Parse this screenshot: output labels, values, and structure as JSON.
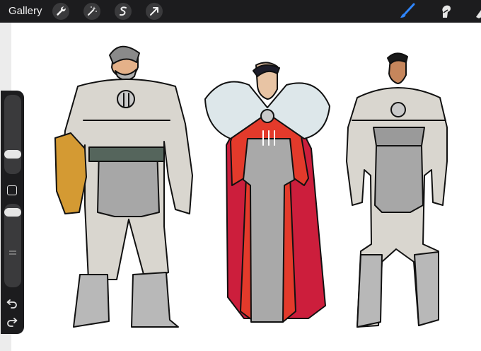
{
  "toolbar": {
    "gallery_label": "Gallery",
    "actions": [
      {
        "icon": "wrench-icon"
      },
      {
        "icon": "magic-wand-icon"
      },
      {
        "icon": "selection-icon"
      },
      {
        "icon": "transform-arrow-icon"
      }
    ],
    "tools": [
      {
        "icon": "brush-icon",
        "active": true,
        "color": "#2f86ff"
      },
      {
        "icon": "smudge-icon",
        "active": false
      },
      {
        "icon": "eraser-icon",
        "active": false
      }
    ]
  },
  "sidebar": {
    "brush_size_level": 0.25,
    "opacity_level": 0.2,
    "buttons": [
      "modify-square-icon",
      "undo-icon",
      "redo-icon"
    ]
  },
  "canvas": {
    "background": "#ffffff",
    "characters": [
      "older-armored-man",
      "caped-noble-with-fur-collar",
      "armored-soldier"
    ]
  }
}
